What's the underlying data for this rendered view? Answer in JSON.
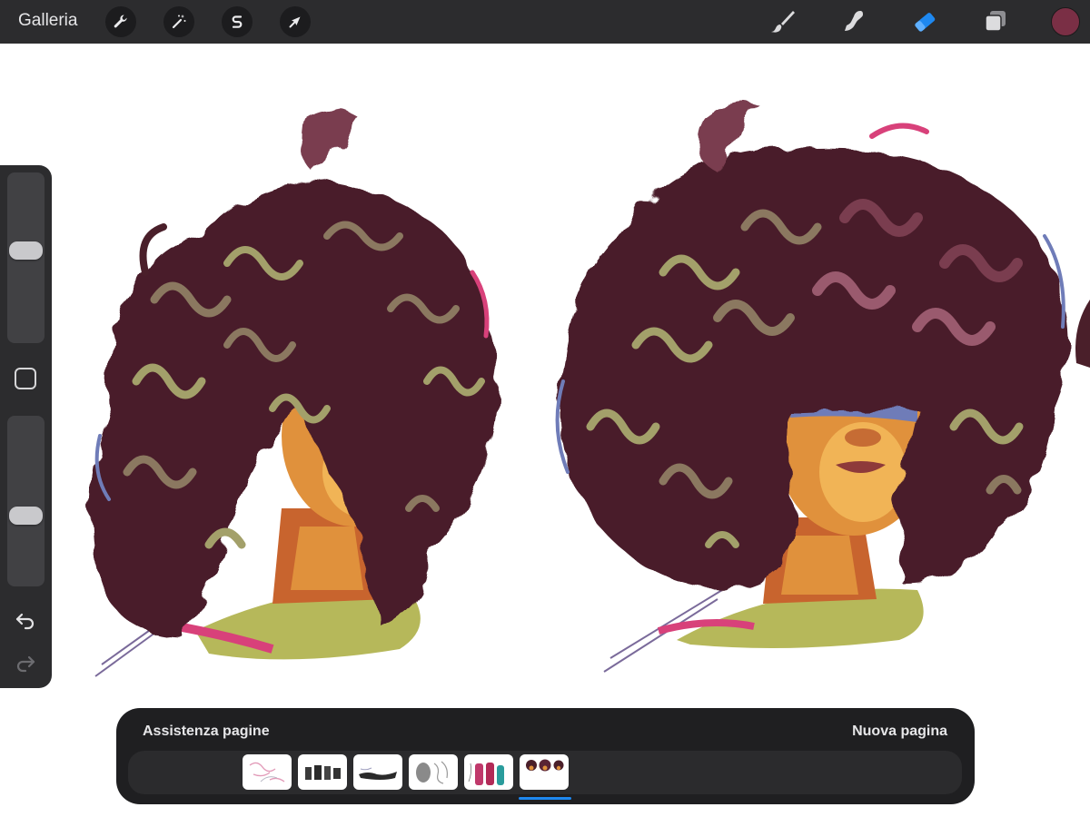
{
  "topbar": {
    "gallery_label": "Galleria",
    "left_tools": [
      {
        "name": "actions",
        "icon": "wrench-icon"
      },
      {
        "name": "adjustments",
        "icon": "magic-wand-icon"
      },
      {
        "name": "selection",
        "icon": "selection-s-icon"
      },
      {
        "name": "transform",
        "icon": "arrow-cursor-icon"
      }
    ],
    "right_tools": [
      {
        "name": "brush",
        "icon": "brush-icon",
        "active": false
      },
      {
        "name": "smudge",
        "icon": "smudge-icon",
        "active": false
      },
      {
        "name": "eraser",
        "icon": "eraser-icon",
        "active": true
      },
      {
        "name": "layers",
        "icon": "layers-icon",
        "active": false
      }
    ],
    "current_color": "#7a2f45"
  },
  "sidebar": {
    "brush_size_level": 0.55,
    "opacity_level": 0.4,
    "icons": [
      "modify-square-icon",
      "undo-icon",
      "redo-icon"
    ]
  },
  "pages_panel": {
    "title": "Assistenza pagine",
    "new_page_label": "Nuova pagina",
    "pages": [
      {
        "icon": "sketch-thumbnail",
        "active": false
      },
      {
        "icon": "figures-thumbnail",
        "active": false
      },
      {
        "icon": "dark-figure-thumbnail",
        "active": false
      },
      {
        "icon": "gray-sketch-thumbnail",
        "active": false
      },
      {
        "icon": "color-figures-thumbnail",
        "active": false
      },
      {
        "icon": "heads-thumbnail",
        "active": true
      }
    ]
  },
  "colors": {
    "bar_bg": "#2c2c2e",
    "panel_bg": "#1f1f21",
    "accent_blue": "#1e88f0",
    "hair_dark": "#4a1f2a",
    "hair_mid": "#7a3d4f",
    "hair_light": "#a3a06a",
    "skin": "#e0913c",
    "sweater": "#b6b85a",
    "magenta": "#d8417a"
  }
}
